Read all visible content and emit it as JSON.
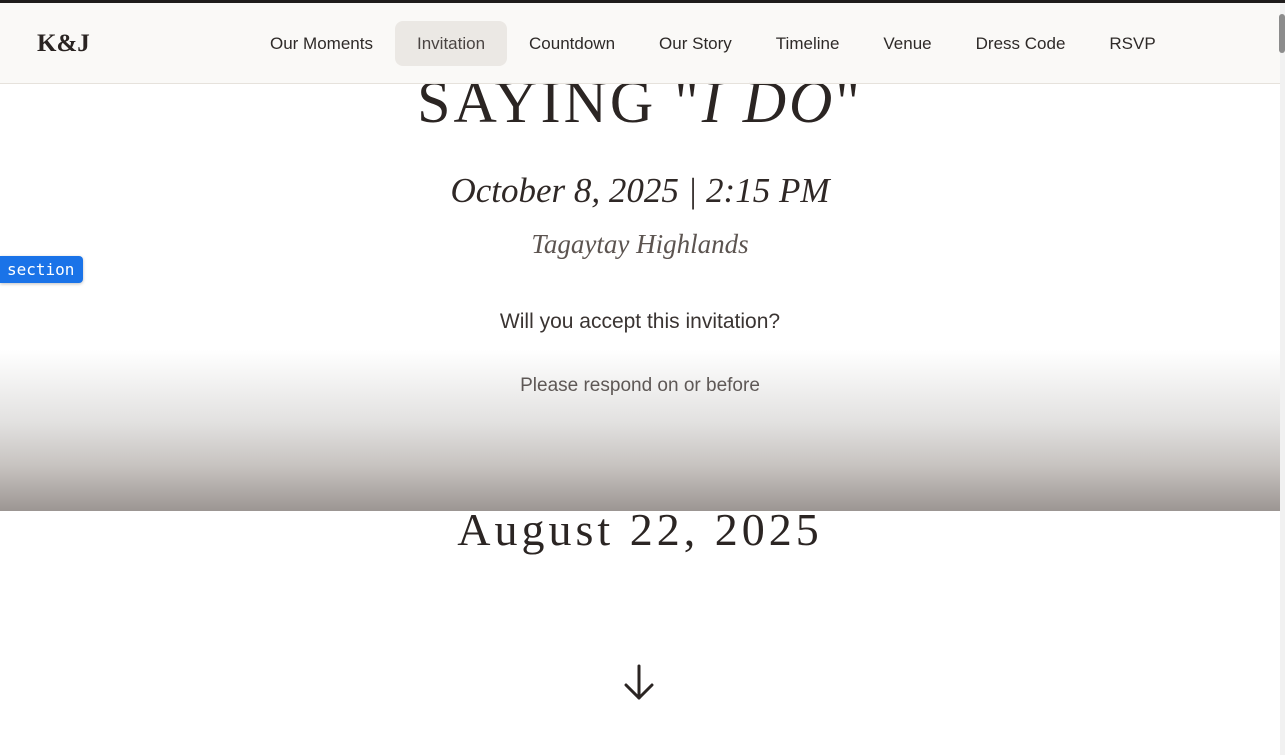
{
  "brand": {
    "monogram": "K&J"
  },
  "nav": {
    "items": [
      {
        "label": "Our Moments",
        "active": false
      },
      {
        "label": "Invitation",
        "active": true
      },
      {
        "label": "Countdown",
        "active": false
      },
      {
        "label": "Our Story",
        "active": false
      },
      {
        "label": "Timeline",
        "active": false
      },
      {
        "label": "Venue",
        "active": false
      },
      {
        "label": "Dress Code",
        "active": false
      },
      {
        "label": "RSVP",
        "active": false
      }
    ]
  },
  "hero": {
    "title_prefix": "SAYING \"",
    "title_italic": "I DO",
    "title_suffix": "\"",
    "date_time": "October 8, 2025 | 2:15 PM",
    "venue": "Tagaytay Highlands",
    "question": "Will you accept this invitation?",
    "respond_text": "Please respond on or before",
    "deadline": "August 22, 2025",
    "scroll_icon": "arrow-down-icon"
  },
  "overlay": {
    "tag_label": "section",
    "tag_color": "#1a73e8"
  },
  "colors": {
    "text_dark": "#2b2523",
    "nav_bg": "#faf9f7",
    "nav_active_bg": "#ebe8e4"
  }
}
